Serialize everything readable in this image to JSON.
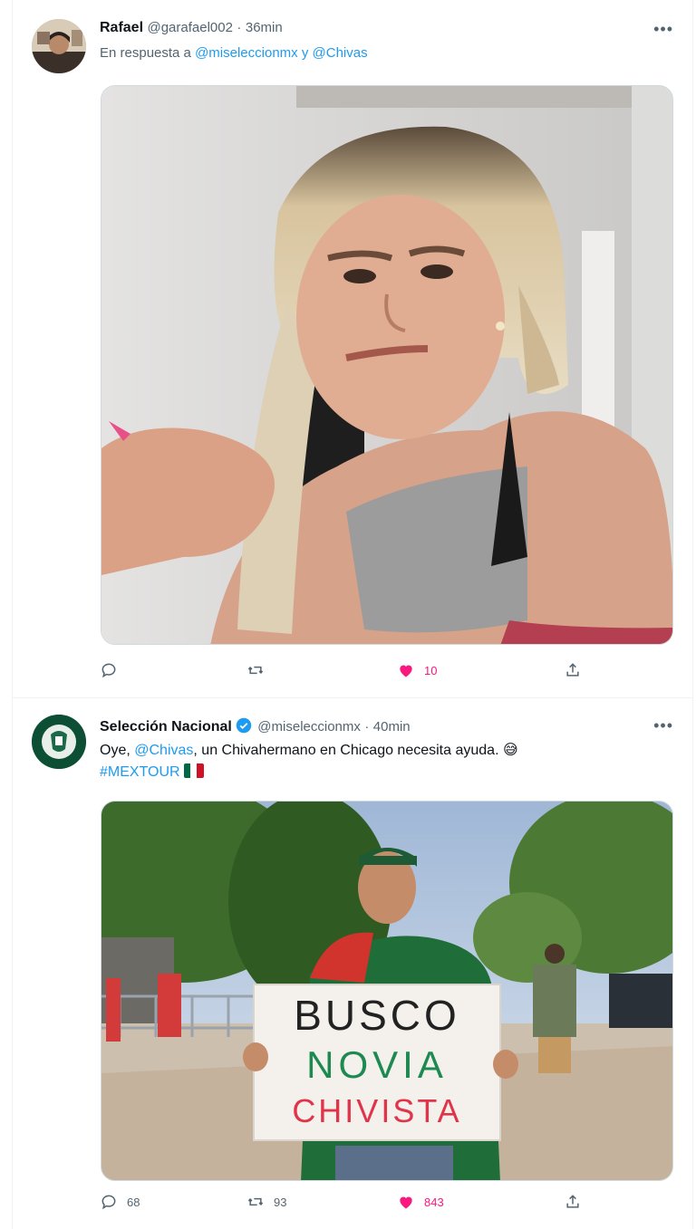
{
  "tweets": [
    {
      "author_name": "Rafael",
      "handle": "@garafael002",
      "separator": "·",
      "time": "36min",
      "reply_prefix": "En respuesta a",
      "reply_to_1": "@miseleccionmx",
      "reply_join": "y",
      "reply_to_2": "@Chivas",
      "stats": {
        "replies": "",
        "retweets": "",
        "likes": "10"
      },
      "liked": true
    },
    {
      "author_name": "Selección Nacional",
      "verified": true,
      "handle": "@miseleccionmx",
      "separator": "·",
      "time": "40min",
      "text_1": "Oye,",
      "mention": "@Chivas",
      "text_2": ", un Chivahermano en Chicago necesita ayuda.",
      "emoji": "😅",
      "hashtag": "#MEXTOUR",
      "image_sign": {
        "line1": "BUSCO",
        "line2": "NOVIA",
        "line3": "CHIVISTA"
      },
      "stats": {
        "replies": "68",
        "retweets": "93",
        "likes": "843"
      },
      "liked": true
    }
  ],
  "icons": [
    "reply-icon",
    "retweet-icon",
    "like-icon",
    "share-icon",
    "more-icon",
    "verified-icon",
    "mexico-flag-icon"
  ],
  "colors": {
    "link": "#1d9bf0",
    "like": "#f91880",
    "secondary_text": "#536471",
    "verified": "#1d9bf0"
  }
}
